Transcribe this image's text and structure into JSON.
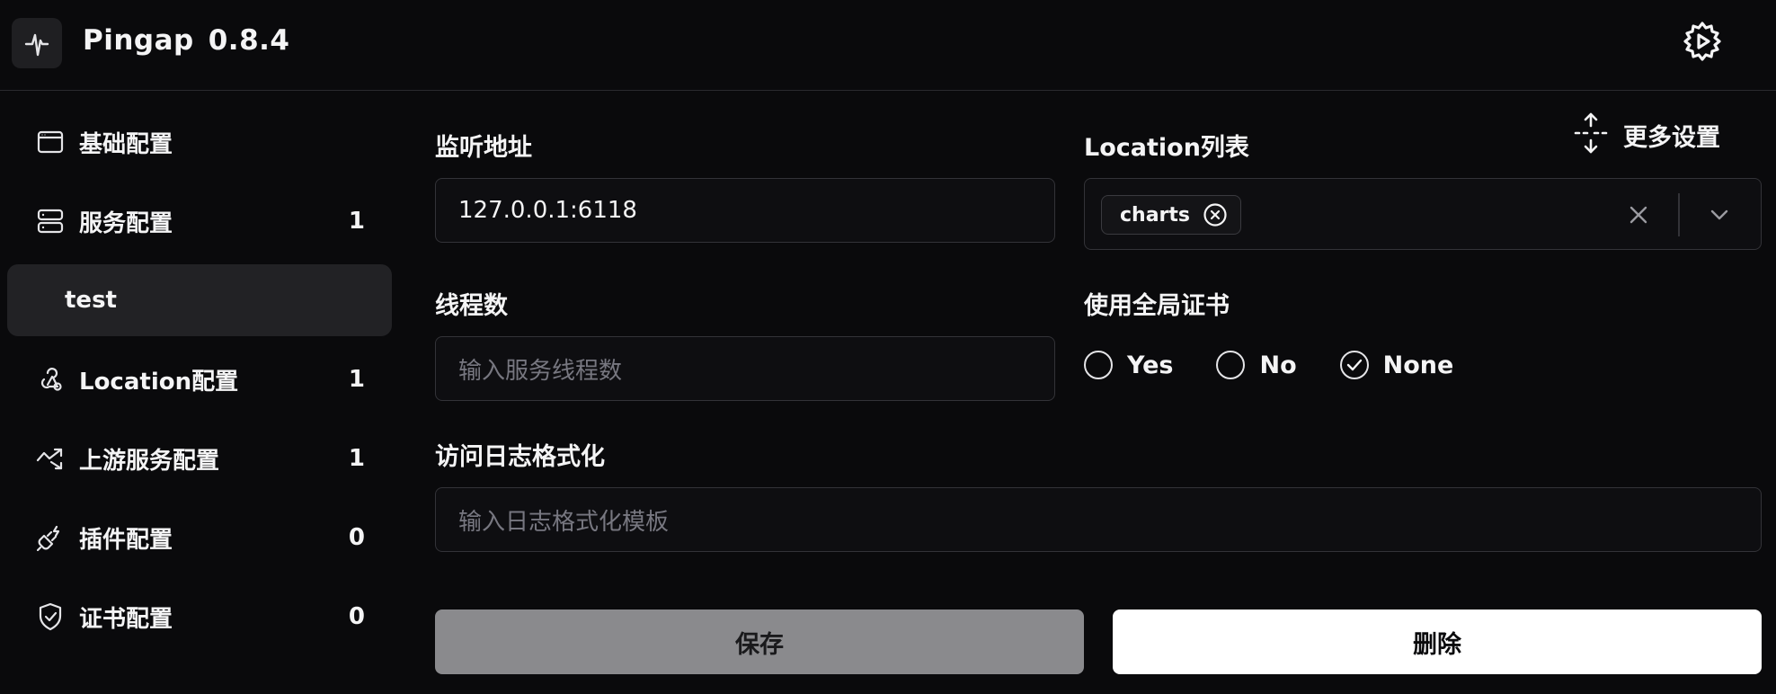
{
  "header": {
    "app_name": "Pingap",
    "version": "0.8.4",
    "logo_icon": "activity-pulse-icon",
    "settings_icon": "gear-icon"
  },
  "sidebar": {
    "items": [
      {
        "label": "基础配置",
        "icon": "browser-window-icon",
        "count": ""
      },
      {
        "label": "服务配置",
        "icon": "server-icon",
        "count": "1"
      },
      {
        "label": "test",
        "icon": "",
        "count": ""
      },
      {
        "label": "Location配置",
        "icon": "webhook-icon",
        "count": "1"
      },
      {
        "label": "上游服务配置",
        "icon": "trending-arrow-icon",
        "count": "1"
      },
      {
        "label": "插件配置",
        "icon": "plug-icon",
        "count": "0"
      },
      {
        "label": "证书配置",
        "icon": "shield-check-icon",
        "count": "0"
      }
    ],
    "selected": "test"
  },
  "form": {
    "more_settings": {
      "label": "更多设置",
      "icon": "expand-arrows-icon"
    },
    "listen_address": {
      "label": "监听地址",
      "value": "127.0.0.1:6118"
    },
    "locations": {
      "label": "Location列表",
      "tags": [
        "charts"
      ]
    },
    "threads": {
      "label": "线程数",
      "placeholder": "输入服务线程数"
    },
    "global_cert": {
      "label": "使用全局证书",
      "options": [
        "Yes",
        "No",
        "None"
      ],
      "selected": "None"
    },
    "access_log": {
      "label": "访问日志格式化",
      "placeholder": "输入日志格式化模板"
    },
    "save_label": "保存",
    "delete_label": "删除"
  },
  "colors": {
    "background": "#0a0a0c",
    "selected_bg": "#222225",
    "save_bg": "#8a8a8d",
    "delete_bg": "#ffffff"
  }
}
